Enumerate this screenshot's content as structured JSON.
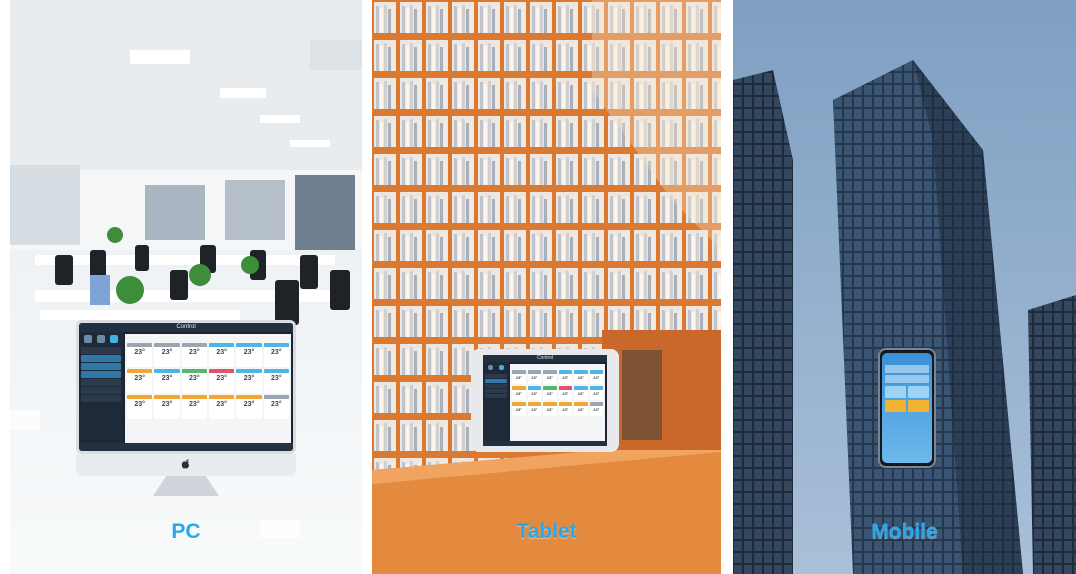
{
  "panels": [
    {
      "id": "pc",
      "caption": "PC"
    },
    {
      "id": "tablet",
      "caption": "Tablet"
    },
    {
      "id": "mobile",
      "caption": "Mobile"
    }
  ],
  "app": {
    "window_title": "Control",
    "tile_temperature": "23°"
  },
  "colors": {
    "caption_blue": "#2aa7e8",
    "app_dark": "#1b2532",
    "tile_blue": "#4fb5e6",
    "tile_gray": "#9aa5b1",
    "tile_green": "#58b86a",
    "tile_orange": "#f2a531",
    "tile_red": "#e2526b"
  },
  "icons": [
    "apple-logo-icon"
  ]
}
